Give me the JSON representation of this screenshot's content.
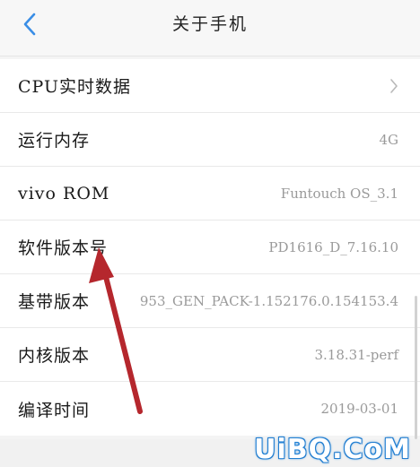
{
  "header": {
    "title": "关于手机"
  },
  "rows": [
    {
      "label": "CPU实时数据",
      "value": "",
      "has_chevron": true
    },
    {
      "label": "运行内存",
      "value": "4G"
    },
    {
      "label": "vivo ROM",
      "value": "Funtouch OS_3.1"
    },
    {
      "label": "软件版本号",
      "value": "PD1616_D_7.16.10"
    },
    {
      "label": "基带版本",
      "value": "953_GEN_PACK-1.152176.0.154153.4"
    },
    {
      "label": "内核版本",
      "value": "3.18.31-perf"
    },
    {
      "label": "编译时间",
      "value": "2019-03-01"
    }
  ],
  "watermark": "UiBQ.CoM",
  "colors": {
    "accent": "#3a8ee6",
    "annotation_arrow": "#b5272d"
  },
  "icons": {
    "back": "chevron-left-icon",
    "row_chevron": "chevron-right-icon"
  }
}
